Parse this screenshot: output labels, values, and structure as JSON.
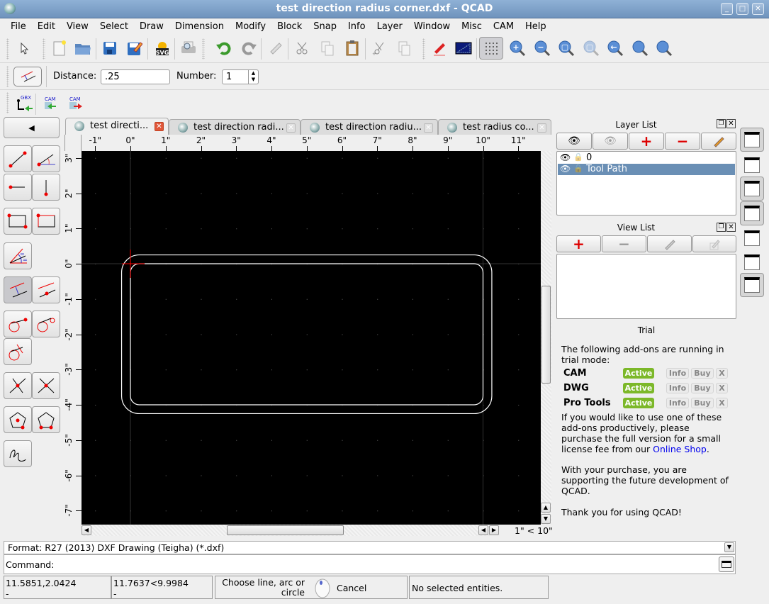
{
  "window": {
    "title": "test direction radius corner.dxf - QCAD"
  },
  "menu": [
    "File",
    "Edit",
    "View",
    "Select",
    "Draw",
    "Dimension",
    "Modify",
    "Block",
    "Snap",
    "Info",
    "Layer",
    "Window",
    "Misc",
    "CAM",
    "Help"
  ],
  "toolbar": {
    "icons": [
      "select-pointer-icon",
      "new-file-icon",
      "open-folder-icon",
      "save-icon",
      "save-as-icon",
      "export-svg-icon",
      "print-preview-icon",
      "undo-icon",
      "redo-icon",
      "eraser-icon",
      "cut-icon",
      "copy-icon",
      "paste-icon",
      "cut-reference-icon",
      "copy-reference-icon",
      "pencil-draw-icon",
      "drawing-area-icon",
      "grid-toggle-icon",
      "zoom-in-icon",
      "zoom-out-icon",
      "zoom-auto-icon",
      "zoom-selection-icon",
      "zoom-previous-icon",
      "zoom-window-icon",
      "zoom-pan-icon"
    ],
    "svg_label": "SVG"
  },
  "options": {
    "distance_label": "Distance:",
    "distance_value": ".25",
    "number_label": "Number:",
    "number_value": "1"
  },
  "cam_toolbar": {
    "gbx_label": "GBX",
    "cam_label": "CAM"
  },
  "tabs": [
    {
      "label": "test directi...",
      "active": true
    },
    {
      "label": "test direction radi...",
      "active": false
    },
    {
      "label": "test direction radiu...",
      "active": false
    },
    {
      "label": "test radius co...",
      "active": false
    }
  ],
  "ruler": {
    "x_ticks": [
      "-1\"",
      "0\"",
      "1\"",
      "2\"",
      "3\"",
      "4\"",
      "5\"",
      "6\"",
      "7\"",
      "8\"",
      "9\"",
      "10\"",
      "11\""
    ],
    "y_ticks": [
      "3\"",
      "2\"",
      "1\"",
      "0\"",
      "-1\"",
      "-2\"",
      "-3\"",
      "-4\"",
      "-5\"",
      "-6\"",
      "-7\""
    ]
  },
  "drawing": {
    "inner_rect_in": {
      "x0": 0,
      "y0": -4,
      "x1": 10,
      "y1": 0,
      "corner_radius": 0.25
    },
    "offset_distance_in": 0.25,
    "colors": {
      "background": "#000000",
      "entities": "#ffffff",
      "crosshair": "#ff0000",
      "grid_dot": "#666666"
    }
  },
  "grid_info": "1\" < 10\"",
  "layer_list": {
    "title": "Layer List",
    "layers": [
      {
        "name": "0",
        "visible": true,
        "locked": false,
        "selected": false
      },
      {
        "name": "Tool Path",
        "visible": true,
        "locked": false,
        "selected": true
      }
    ]
  },
  "view_list": {
    "title": "View List"
  },
  "trial": {
    "title": "Trial",
    "intro": "The following add-ons are running in trial mode:",
    "addons": [
      {
        "name": "CAM",
        "status": "Active"
      },
      {
        "name": "DWG",
        "status": "Active"
      },
      {
        "name": "Pro Tools",
        "status": "Active"
      }
    ],
    "info_label": "Info",
    "buy_label": "Buy",
    "x_label": "X",
    "p1_before": "If you would like to use one of these add-ons productively, please purchase the full version for a small license fee from our ",
    "p1_link": "Online Shop",
    "p1_after": ".",
    "p2": "With your purchase, you are supporting the future development of QCAD.",
    "p3": "Thank you for using QCAD!",
    "link_color": "#0000ee",
    "active_color": "#7cb829"
  },
  "format_bar": "Format: R27 (2013) DXF Drawing (Teigha) (*.dxf)",
  "command_label": "Command:",
  "status": {
    "abs_coord": "11.5851,2.0424",
    "abs_sub": "-",
    "polar_coord": "11.7637<9.9984",
    "polar_sub": "-",
    "prompt": "Choose line, arc or circle",
    "right_action": "Cancel",
    "selection": "No selected entities."
  }
}
